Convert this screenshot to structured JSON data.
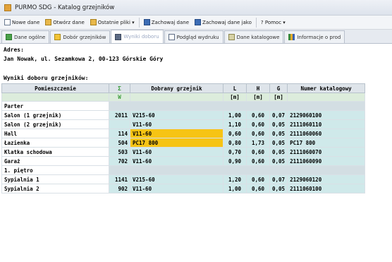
{
  "window": {
    "title": "PURMO SDG - Katalog grzejników"
  },
  "toolbar": {
    "items": [
      {
        "label": "Nowe dane",
        "icon": "new-document-icon"
      },
      {
        "label": "Otwórz dane",
        "icon": "open-folder-icon"
      },
      {
        "label": "Ostatnie pliki ▾",
        "icon": "recent-files-icon"
      },
      {
        "label": "Zachowaj dane",
        "icon": "save-icon"
      },
      {
        "label": "Zachowaj dane jako",
        "icon": "save-as-icon"
      },
      {
        "label": "? Pomoc ▾",
        "icon": "help-icon"
      }
    ]
  },
  "tabs": [
    {
      "label": "Dane ogólne",
      "icon": "general-data-icon"
    },
    {
      "label": "Dobór grzejników",
      "icon": "radiator-selection-icon"
    },
    {
      "label": "Wyniki doboru",
      "icon": "results-book-icon",
      "active": true
    },
    {
      "label": "Podgląd wydruku",
      "icon": "print-preview-icon"
    },
    {
      "label": "Dane katalogowe",
      "icon": "catalog-data-icon"
    },
    {
      "label": "Informacje o prod",
      "icon": "product-info-icon"
    }
  ],
  "address": {
    "label": "Adres:",
    "value": "Jan Nowak, ul. Sezamkowa 2, 00-123 Górskie Góry"
  },
  "results": {
    "label": "Wyniki doboru grzejników:",
    "headers": [
      "Pomieszczenie",
      "Σ",
      "Dobrany grzejnik",
      "L",
      "H",
      "G",
      "Numer katalogowy"
    ],
    "subheaders": [
      "",
      "W",
      "",
      "[m]",
      "[m]",
      "[m]",
      ""
    ],
    "sections": [
      {
        "floor": "Parter",
        "rows": [
          {
            "room": "Salon (1 grzejnik)",
            "power": "2011",
            "radiator": "V215-60",
            "l": "1,00",
            "h": "0,60",
            "g": "0,07",
            "catalog": "2129060100",
            "highlight": false
          },
          {
            "room": "Salon (2 grzejnik)",
            "power": "",
            "radiator": "V11-60",
            "l": "1,10",
            "h": "0,60",
            "g": "0,05",
            "catalog": "2111060110",
            "highlight": false
          },
          {
            "room": "Hall",
            "power": "114",
            "radiator": "V11-60",
            "l": "0,60",
            "h": "0,60",
            "g": "0,05",
            "catalog": "2111060060",
            "highlight": true
          },
          {
            "room": "Łazienka",
            "power": "504",
            "radiator": "PC17 800",
            "l": "0,80",
            "h": "1,73",
            "g": "0,05",
            "catalog": "PC17 800",
            "highlight": true
          },
          {
            "room": "Klatka schodowa",
            "power": "503",
            "radiator": "V11-60",
            "l": "0,70",
            "h": "0,60",
            "g": "0,05",
            "catalog": "2111060070",
            "highlight": false
          },
          {
            "room": "Garaż",
            "power": "702",
            "radiator": "V11-60",
            "l": "0,90",
            "h": "0,60",
            "g": "0,05",
            "catalog": "2111060090",
            "highlight": false
          }
        ]
      },
      {
        "floor": "1. piętro",
        "rows": [
          {
            "room": "Sypialnia 1",
            "power": "1141",
            "radiator": "V215-60",
            "l": "1,20",
            "h": "0,60",
            "g": "0,07",
            "catalog": "2129060120",
            "highlight": false
          },
          {
            "room": "Sypialnia 2",
            "power": "902",
            "radiator": "V11-60",
            "l": "1,00",
            "h": "0,60",
            "g": "0,05",
            "catalog": "2111060100",
            "highlight": false
          }
        ]
      }
    ]
  }
}
